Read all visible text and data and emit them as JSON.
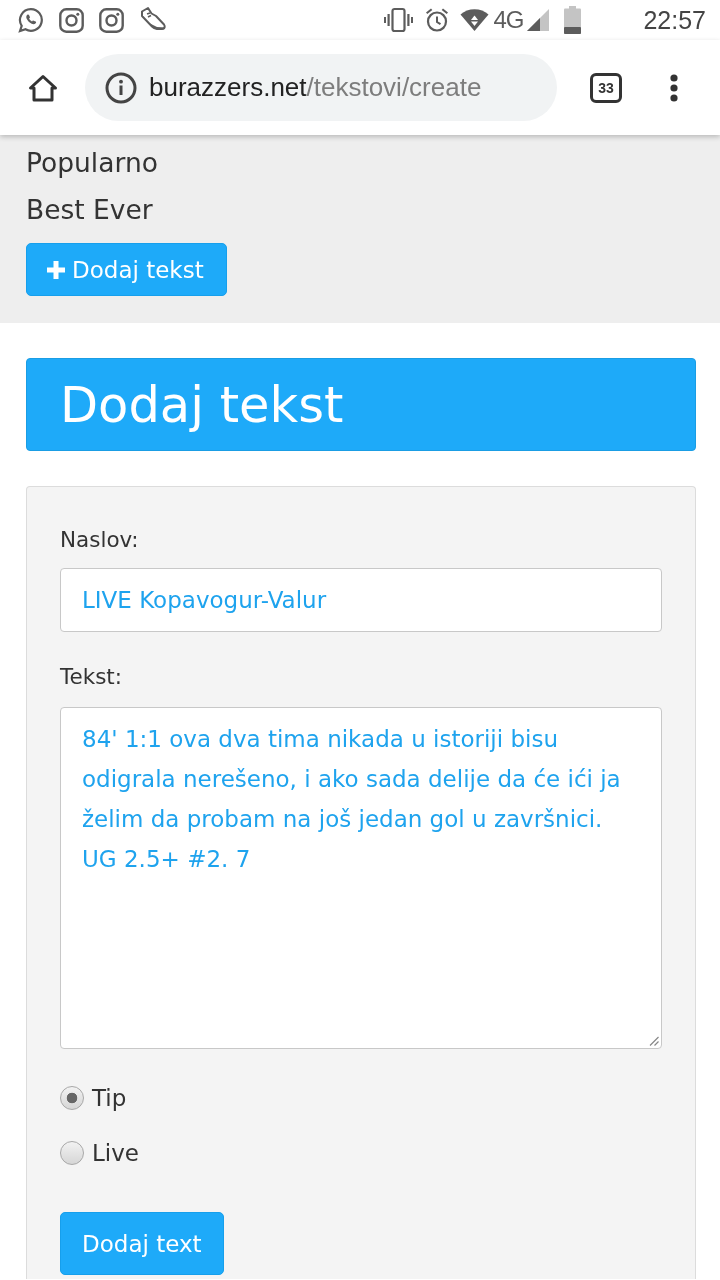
{
  "status_bar": {
    "network": "4G",
    "time": "22:57"
  },
  "browser": {
    "url_host": "burazzers.net",
    "url_path": "/tekstovi/create",
    "tab_count": "33"
  },
  "nav": {
    "links": [
      "Popularno",
      "Best Ever"
    ],
    "add_button": "Dodaj tekst"
  },
  "page_title": "Dodaj tekst",
  "form": {
    "fields": [
      {
        "kind": "input",
        "label": "Naslov:",
        "value": "LIVE Kopavogur-Valur"
      },
      {
        "kind": "textarea",
        "label": "Tekst:",
        "value": "84' 1:1 ova dva tima nikada u istoriji bisu odigrala nerešeno, i ako sada delije da će ići ja želim da probam na još jedan gol u završnici. UG 2.5+ #2. 7"
      }
    ],
    "options": [
      {
        "label": "Tip",
        "selected": true
      },
      {
        "label": "Live",
        "selected": false
      }
    ],
    "submit": "Dodaj text"
  }
}
